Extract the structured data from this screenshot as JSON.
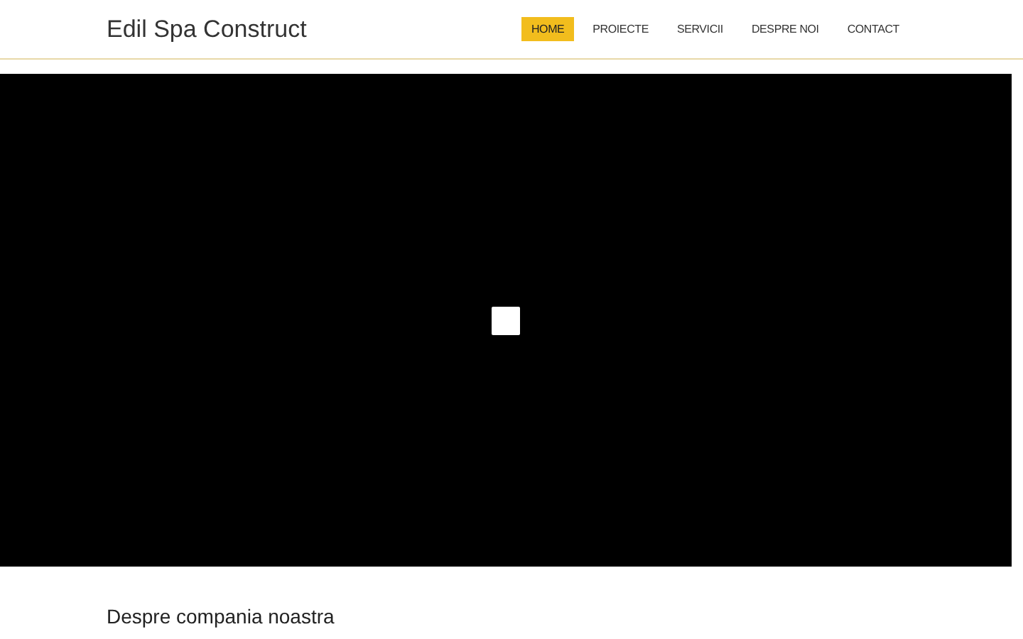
{
  "header": {
    "logo": "Edil Spa Construct",
    "nav": [
      {
        "label": "HOME",
        "selected": true
      },
      {
        "label": "PROIECTE",
        "selected": false
      },
      {
        "label": "SERVICII",
        "selected": false
      },
      {
        "label": "DESPRE NOI",
        "selected": false
      },
      {
        "label": "CONTACT",
        "selected": false
      }
    ]
  },
  "video": {
    "kind": "video"
  },
  "about": {
    "title": "Despre compania noastra"
  }
}
